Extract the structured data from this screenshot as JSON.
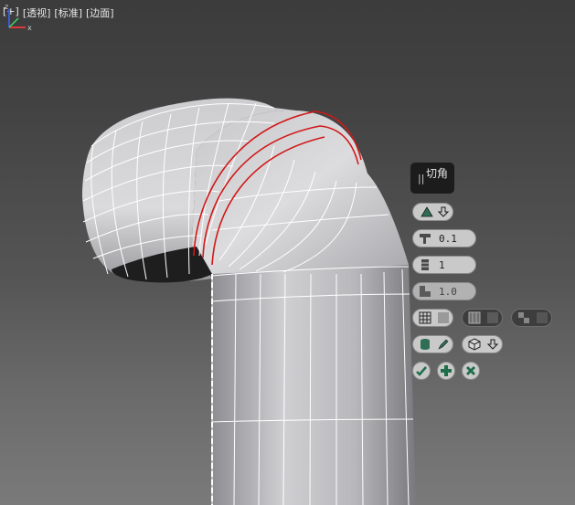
{
  "viewport": {
    "label_plus": "[+]",
    "label_view": "[透视]",
    "label_shading": "[标准]",
    "label_edges": "[边面]"
  },
  "caddy": {
    "title": "切角",
    "grip_icon": "drag-grip-icon",
    "amount": "0.1",
    "segments": "1",
    "tension": "1.0"
  },
  "axis": {
    "z": "z",
    "x": "x"
  },
  "colors": {
    "selection_edge": "#d11818",
    "wire": "#ffffff",
    "caddy_bg": "#1c1c1c",
    "button_bg": "#c9c9c9",
    "ok_icon": "#1f6e4a"
  }
}
